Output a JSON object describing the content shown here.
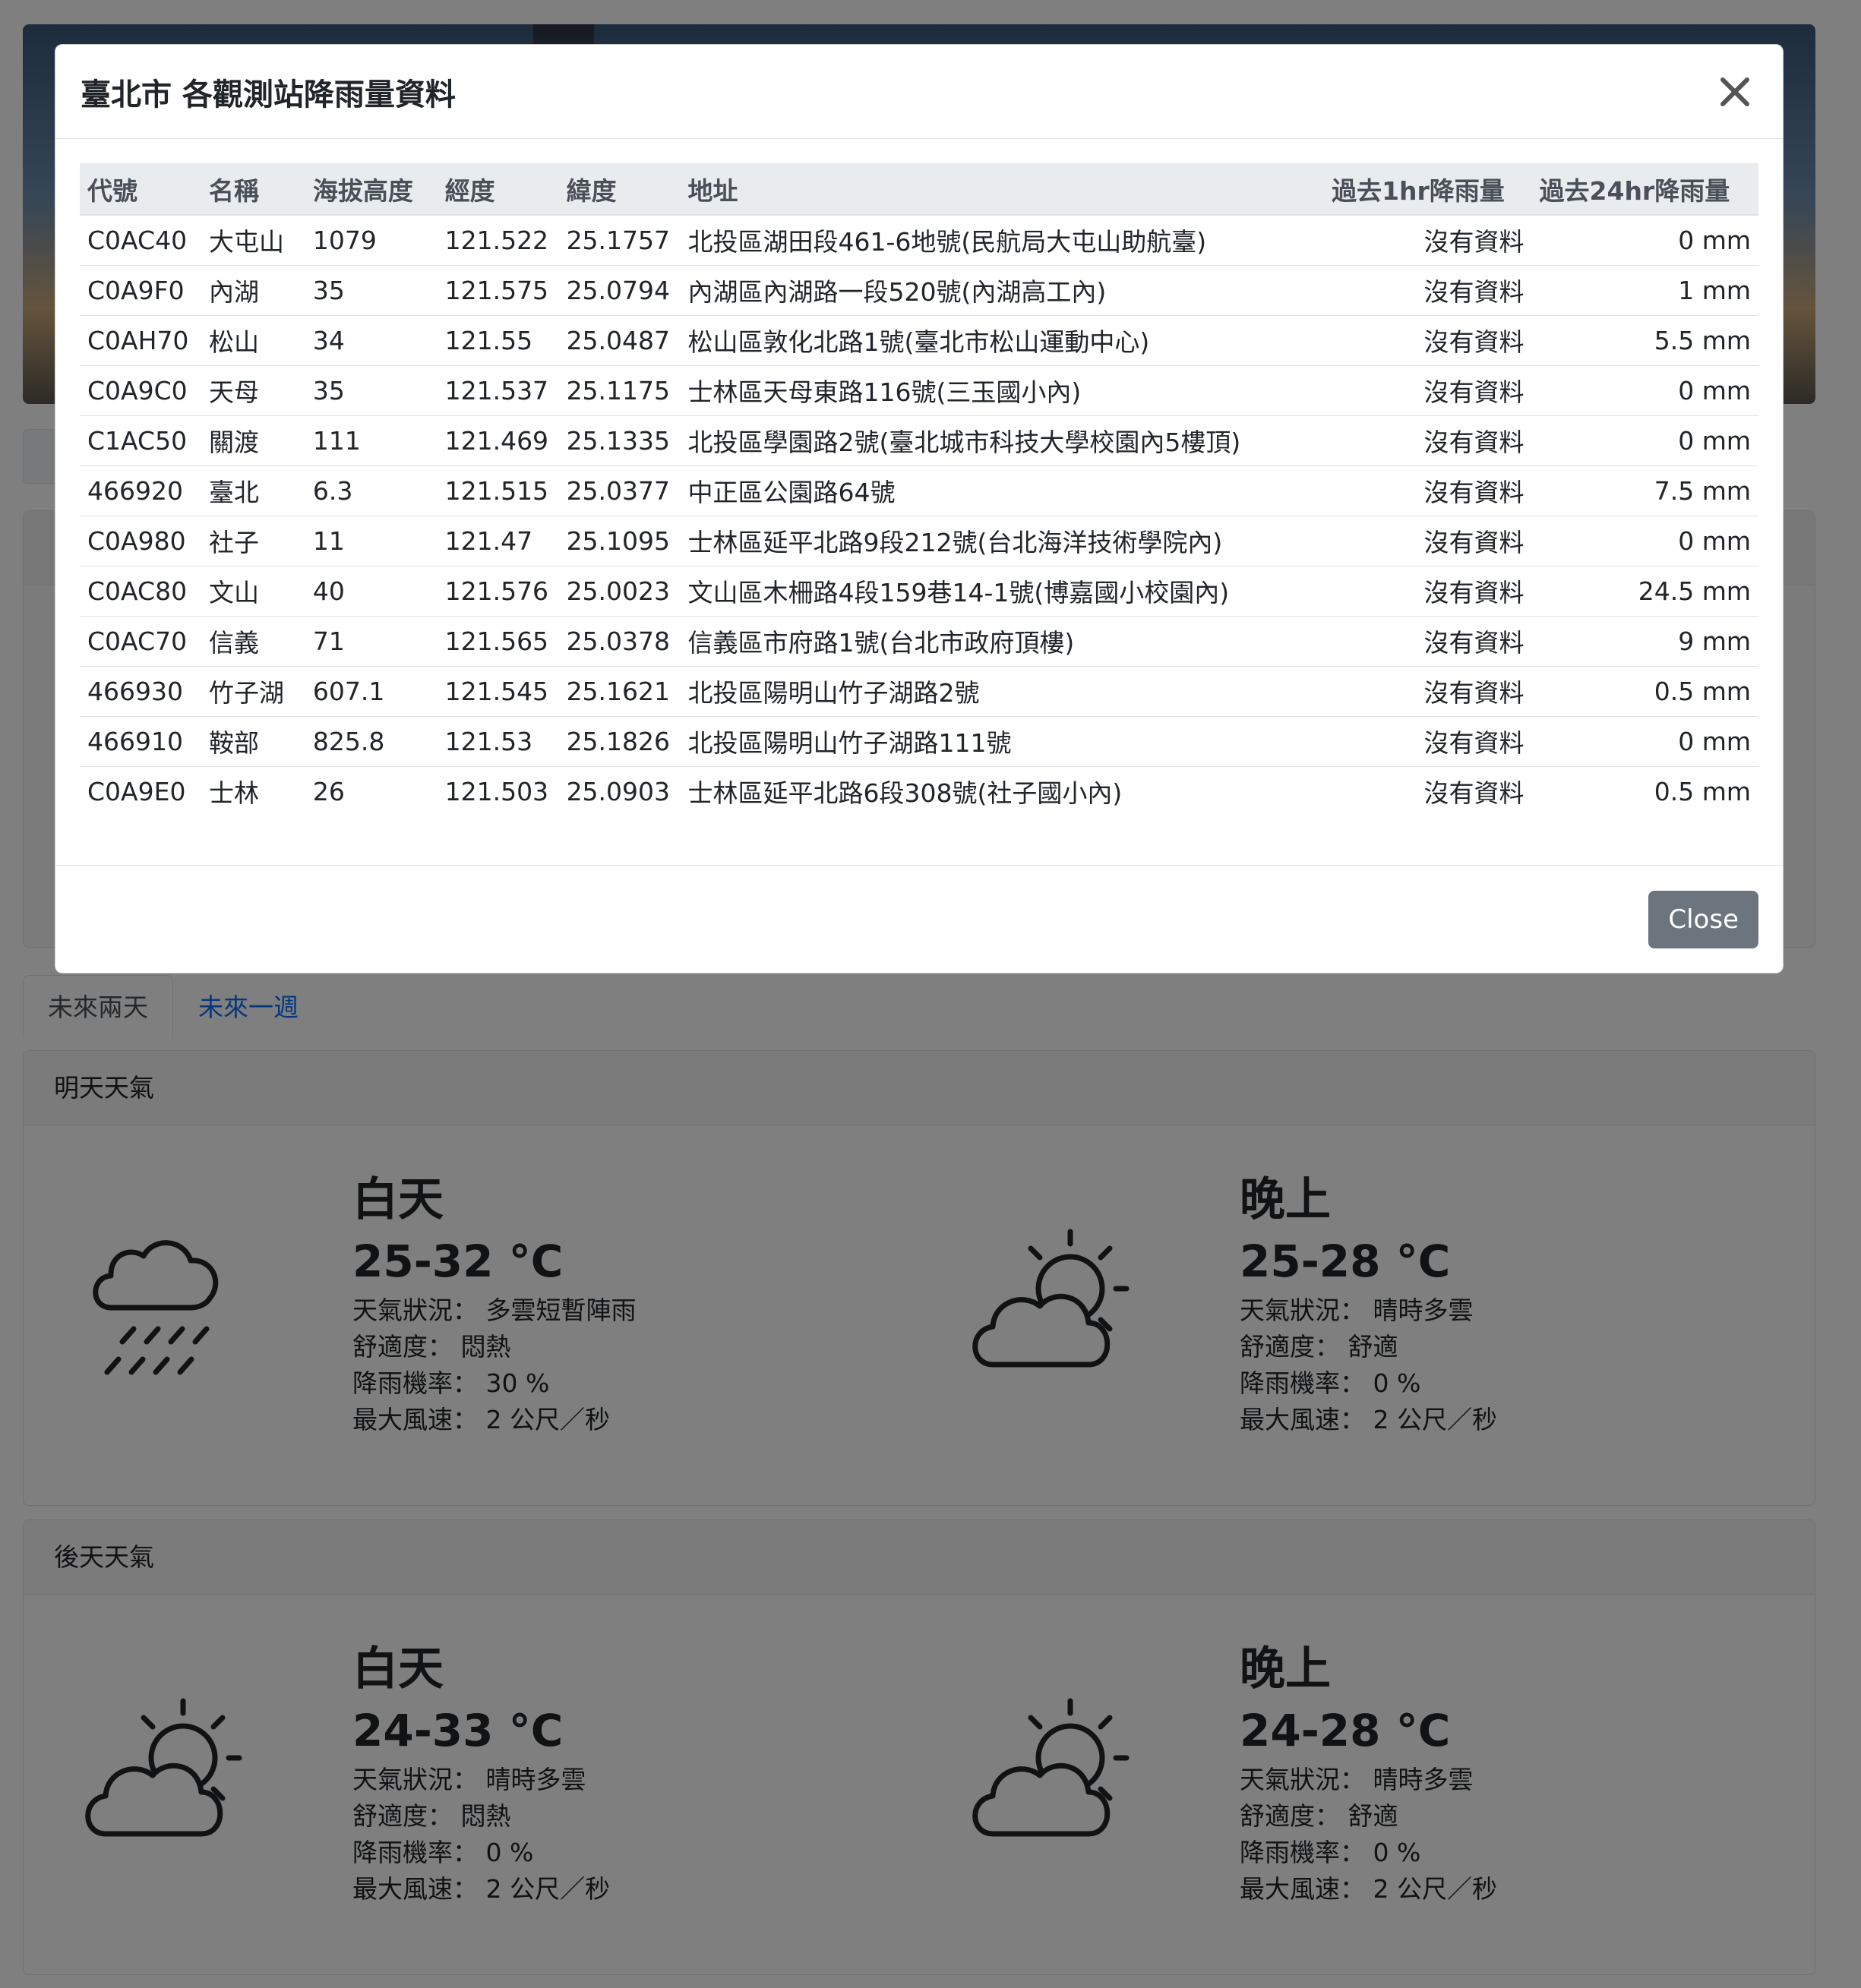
{
  "modal": {
    "title": "臺北市 各觀測站降雨量資料",
    "close_button": "Close",
    "columns": [
      "代號",
      "名稱",
      "海拔高度",
      "經度",
      "緯度",
      "地址",
      "過去1hr降雨量",
      "過去24hr降雨量"
    ],
    "rows": [
      [
        "C0AC40",
        "大屯山",
        "1079",
        "121.522",
        "25.1757",
        "北投區湖田段461-6地號(民航局大屯山助航臺)",
        "沒有資料",
        "0 mm"
      ],
      [
        "C0A9F0",
        "內湖",
        "35",
        "121.575",
        "25.0794",
        "內湖區內湖路一段520號(內湖高工內)",
        "沒有資料",
        "1 mm"
      ],
      [
        "C0AH70",
        "松山",
        "34",
        "121.55",
        "25.0487",
        "松山區敦化北路1號(臺北市松山運動中心)",
        "沒有資料",
        "5.5 mm"
      ],
      [
        "C0A9C0",
        "天母",
        "35",
        "121.537",
        "25.1175",
        "士林區天母東路116號(三玉國小內)",
        "沒有資料",
        "0 mm"
      ],
      [
        "C1AC50",
        "關渡",
        "111",
        "121.469",
        "25.1335",
        "北投區學園路2號(臺北城市科技大學校園內5樓頂)",
        "沒有資料",
        "0 mm"
      ],
      [
        "466920",
        "臺北",
        "6.3",
        "121.515",
        "25.0377",
        "中正區公園路64號",
        "沒有資料",
        "7.5 mm"
      ],
      [
        "C0A980",
        "社子",
        "11",
        "121.47",
        "25.1095",
        "士林區延平北路9段212號(台北海洋技術學院內)",
        "沒有資料",
        "0 mm"
      ],
      [
        "C0AC80",
        "文山",
        "40",
        "121.576",
        "25.0023",
        "文山區木柵路4段159巷14-1號(博嘉國小校園內)",
        "沒有資料",
        "24.5 mm"
      ],
      [
        "C0AC70",
        "信義",
        "71",
        "121.565",
        "25.0378",
        "信義區市府路1號(台北市政府頂樓)",
        "沒有資料",
        "9 mm"
      ],
      [
        "466930",
        "竹子湖",
        "607.1",
        "121.545",
        "25.1621",
        "北投區陽明山竹子湖路2號",
        "沒有資料",
        "0.5 mm"
      ],
      [
        "466910",
        "鞍部",
        "825.8",
        "121.53",
        "25.1826",
        "北投區陽明山竹子湖路111號",
        "沒有資料",
        "0 mm"
      ],
      [
        "C0A9E0",
        "士林",
        "26",
        "121.503",
        "25.0903",
        "士林區延平北路6段308號(社子國小內)",
        "沒有資料",
        "0.5 mm"
      ]
    ]
  },
  "tabs": [
    "未來兩天",
    "未來一週"
  ],
  "labels": {
    "weather": "天氣狀況：",
    "comfort": "舒適度：",
    "rain": "降雨機率：",
    "wind": "最大風速："
  },
  "forecast": [
    {
      "header": "明天天氣",
      "periods": [
        {
          "title": "白天",
          "temp": "25-32 °C",
          "weather": "多雲短暫陣雨",
          "comfort": "悶熱",
          "rain": "30 %",
          "wind": "2 公尺／秒",
          "icon": "rain-cloud-icon"
        },
        {
          "title": "晚上",
          "temp": "25-28 °C",
          "weather": "晴時多雲",
          "comfort": "舒適",
          "rain": "0 %",
          "wind": "2 公尺／秒",
          "icon": "partly-sunny-icon"
        }
      ]
    },
    {
      "header": "後天天氣",
      "periods": [
        {
          "title": "白天",
          "temp": "24-33 °C",
          "weather": "晴時多雲",
          "comfort": "悶熱",
          "rain": "0 %",
          "wind": "2 公尺／秒",
          "icon": "partly-sunny-icon"
        },
        {
          "title": "晚上",
          "temp": "24-28 °C",
          "weather": "晴時多雲",
          "comfort": "舒適",
          "rain": "0 %",
          "wind": "2 公尺／秒",
          "icon": "partly-sunny-icon"
        }
      ]
    }
  ],
  "colors": {
    "link": "#0d6efd",
    "button_secondary": "#6c757d",
    "backdrop": "rgba(0,0,0,0.5)"
  }
}
